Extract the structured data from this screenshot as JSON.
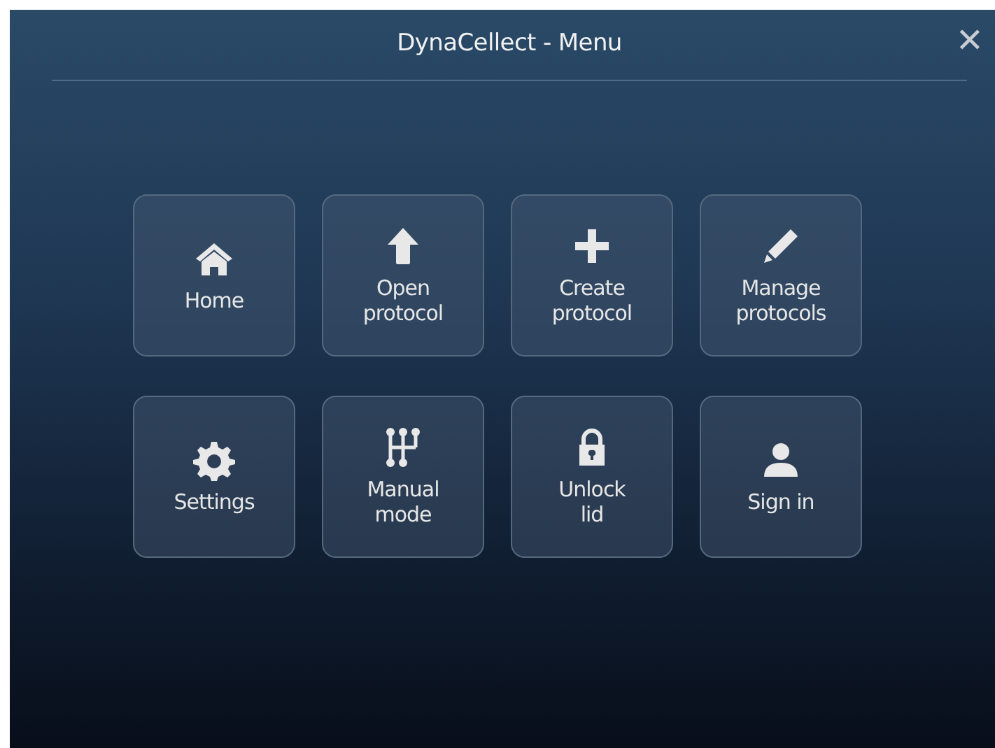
{
  "window": {
    "title": "DynaCellect - Menu",
    "close": "✕"
  },
  "menu": [
    {
      "label": "Home"
    },
    {
      "label": "Open\nprotocol"
    },
    {
      "label": "Create\nprotocol"
    },
    {
      "label": "Manage\nprotocols"
    },
    {
      "label": "Settings"
    },
    {
      "label": "Manual\nmode"
    },
    {
      "label": "Unlock\nlid"
    },
    {
      "label": "Sign in"
    }
  ]
}
